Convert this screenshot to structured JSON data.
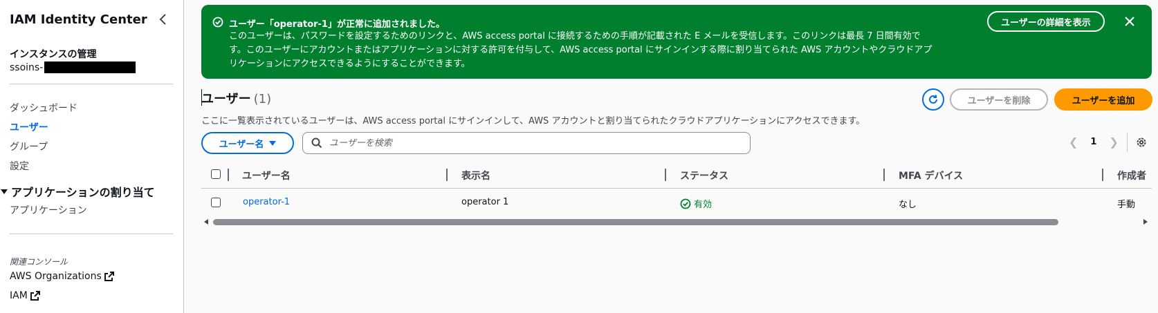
{
  "sidebar": {
    "title": "IAM Identity Center",
    "section_label": "インスタンスの管理",
    "instance_prefix": "ssoins-",
    "nav": [
      "ダッシュボード",
      "ユーザー",
      "グループ",
      "設定"
    ],
    "group_title": "アプリケーションの割り当て",
    "group_items": [
      "アプリケーション"
    ],
    "related_label": "関連コンソール",
    "related_links": [
      "AWS Organizations",
      "IAM"
    ]
  },
  "banner": {
    "title": "ユーザー「operator-1」が正常に追加されました。",
    "body_line1": "このユーザーは、パスワードを設定するためのリンクと、AWS access portal に接続するための手順が記載された E メールを受信します。このリンクは最長 7 日間有効で",
    "body_line2": "す。このユーザーにアカウントまたはアプリケーションに対する許可を付与して、AWS access portal にサインインする際に割り当てられた AWS アカウントやクラウドアプ",
    "body_line3": "リケーションにアクセスできるようにすることができます。",
    "button": "ユーザーの詳細を表示"
  },
  "header": {
    "title": "ユーザー",
    "count": "(1)",
    "description": "ここに一覧表示されているユーザーは、AWS access portal にサインインして、AWS アカウントと割り当てられたクラウドアプリケーションにアクセスできます。",
    "delete_button": "ユーザーを削除",
    "add_button": "ユーザーを追加"
  },
  "filter": {
    "property": "ユーザー名",
    "placeholder": "ユーザーを検索"
  },
  "pagination": {
    "current_page": "1"
  },
  "table": {
    "columns": [
      "ユーザー名",
      "表示名",
      "ステータス",
      "MFA デバイス",
      "作成者"
    ],
    "rows": [
      {
        "username": "operator-1",
        "display_name": "operator 1",
        "status": "有効",
        "mfa": "なし",
        "created_by": "手動"
      }
    ]
  },
  "colors": {
    "success": "#00802f",
    "link": "#006ce0",
    "primary": "#ff9900"
  }
}
